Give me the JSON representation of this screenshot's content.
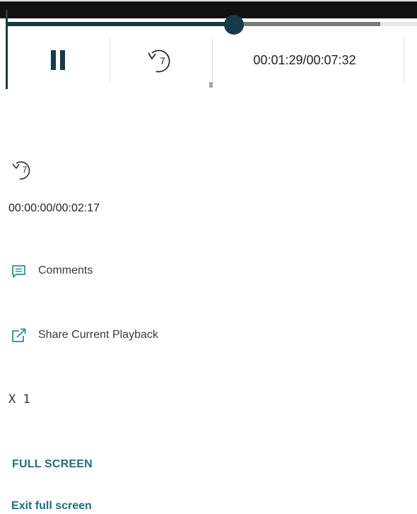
{
  "player": {
    "playback_progress_fraction": 0.555,
    "buffer_progress_fraction": 0.91,
    "pause_label": "Pause",
    "rewind_seconds": "7",
    "time_display": "00:01:29/00:07:32"
  },
  "secondary": {
    "rewind_seconds": "7",
    "time_display": "00:00:00/00:02:17"
  },
  "actions": {
    "comments_label": "Comments",
    "share_label": "Share Current Playback",
    "speed_label": "X 1",
    "full_screen_label": "FULL SCREEN",
    "exit_full_screen_label": "Exit full screen"
  },
  "colors": {
    "accent_dark": "#173a4a",
    "link_teal": "#206b81",
    "icon_teal": "#2a8aa3"
  }
}
